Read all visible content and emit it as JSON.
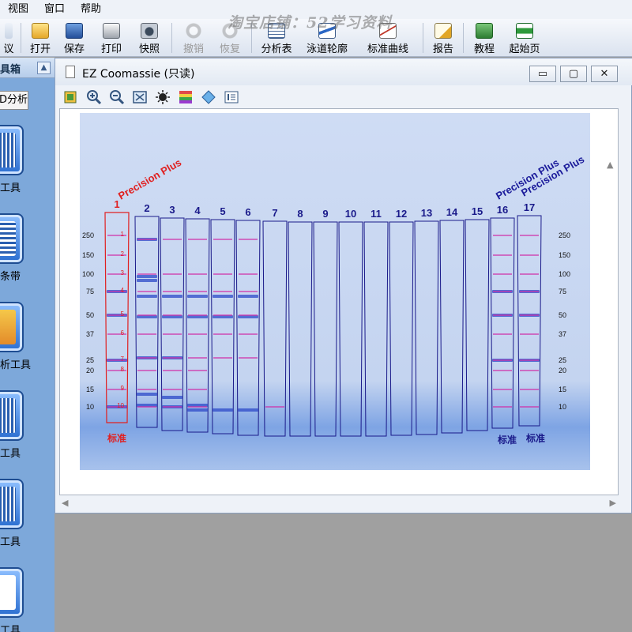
{
  "menubar": {
    "items": [
      "视图",
      "窗口",
      "帮助"
    ]
  },
  "watermark": "淘宝店铺：52学习资料",
  "toolbar": {
    "buttons": [
      {
        "label": "议",
        "icon": "protocol-icon",
        "disabled": false
      },
      {
        "label": "打开",
        "icon": "folder-open-icon",
        "disabled": false
      },
      {
        "label": "保存",
        "icon": "floppy-disk-icon",
        "disabled": false
      },
      {
        "label": "打印",
        "icon": "printer-icon",
        "disabled": false
      },
      {
        "label": "快照",
        "icon": "camera-icon",
        "disabled": false
      },
      {
        "label": "撤销",
        "icon": "undo-icon",
        "disabled": true
      },
      {
        "label": "恢复",
        "icon": "redo-icon",
        "disabled": true
      },
      {
        "label": "分析表",
        "icon": "table-icon",
        "disabled": false
      },
      {
        "label": "泳道轮廓",
        "icon": "lane-profile-icon",
        "disabled": false
      },
      {
        "label": "标准曲线",
        "icon": "standard-curve-icon",
        "disabled": false
      },
      {
        "label": "报告",
        "icon": "report-icon",
        "disabled": false
      },
      {
        "label": "教程",
        "icon": "tutorial-icon",
        "disabled": false
      },
      {
        "label": "起始页",
        "icon": "start-page-icon",
        "disabled": false
      }
    ]
  },
  "left_panel": {
    "title": "具箱",
    "analysis_button": "D分析",
    "tools": [
      {
        "label": "工具"
      },
      {
        "label": "条带"
      },
      {
        "label": "析工具"
      },
      {
        "label": "工具"
      },
      {
        "label": "工具"
      },
      {
        "label": "工具"
      }
    ]
  },
  "window": {
    "title": "EZ Coomassie (只读)",
    "controls": {
      "minimize": "▭",
      "maximize": "▢",
      "close": "✕"
    }
  },
  "image_toolbar": {
    "icons": [
      "image-adjust-icon",
      "zoom-in-icon",
      "zoom-out-icon",
      "fit-window-icon",
      "brightness-icon",
      "color-palette-icon",
      "tag-icon",
      "info-icon"
    ]
  },
  "gel": {
    "lane_numbers": [
      "1",
      "2",
      "3",
      "4",
      "5",
      "6",
      "7",
      "8",
      "9",
      "10",
      "11",
      "12",
      "13",
      "14",
      "15",
      "16",
      "17"
    ],
    "standard_label_left": "Precision Plus",
    "standard_label_right_a": "Precision Plus",
    "standard_label_right_b": "Precision Plus",
    "mw_markers_left": [
      "250",
      "150",
      "100",
      "75",
      "50",
      "37",
      "25",
      "20",
      "15",
      "10"
    ],
    "mw_markers_right": [
      "250",
      "150",
      "100",
      "75",
      "50",
      "37",
      "25",
      "20",
      "15",
      "10"
    ],
    "band_numbers": [
      "1",
      "2",
      "3",
      "4",
      "5",
      "6",
      "7",
      "8",
      "9",
      "10"
    ],
    "footer_left": "标准",
    "footer_right_a": "标准",
    "footer_right_b": "标准"
  }
}
